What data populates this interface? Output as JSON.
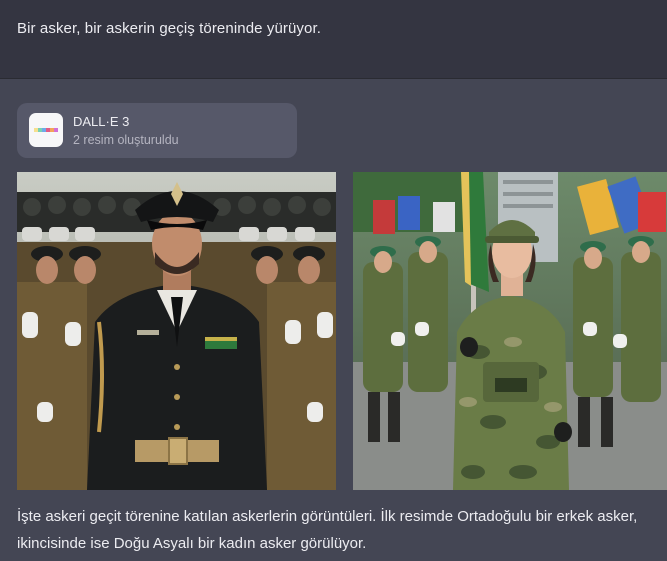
{
  "user_message": {
    "text": "Bir asker, bir askerin geçiş töreninde yürüyor."
  },
  "assistant": {
    "tool_card": {
      "icon": "dalle-palette-icon",
      "title": "DALL·E 3",
      "subtitle": "2 resim oluşturuldu"
    },
    "images": [
      {
        "icon": "generated-image-soldier-man"
      },
      {
        "icon": "generated-image-soldier-woman"
      }
    ],
    "caption": "İşte askeri geçit törenine katılan askerlerin görüntüleri. İlk resimde Ortadoğulu bir erkek asker, ikincisinde ise Doğu Asyalı bir kadın asker görülüyor."
  },
  "colors": {
    "user_bg": "#343541",
    "assistant_bg": "#444654",
    "card_bg": "#565869",
    "text": "#ececf1"
  }
}
